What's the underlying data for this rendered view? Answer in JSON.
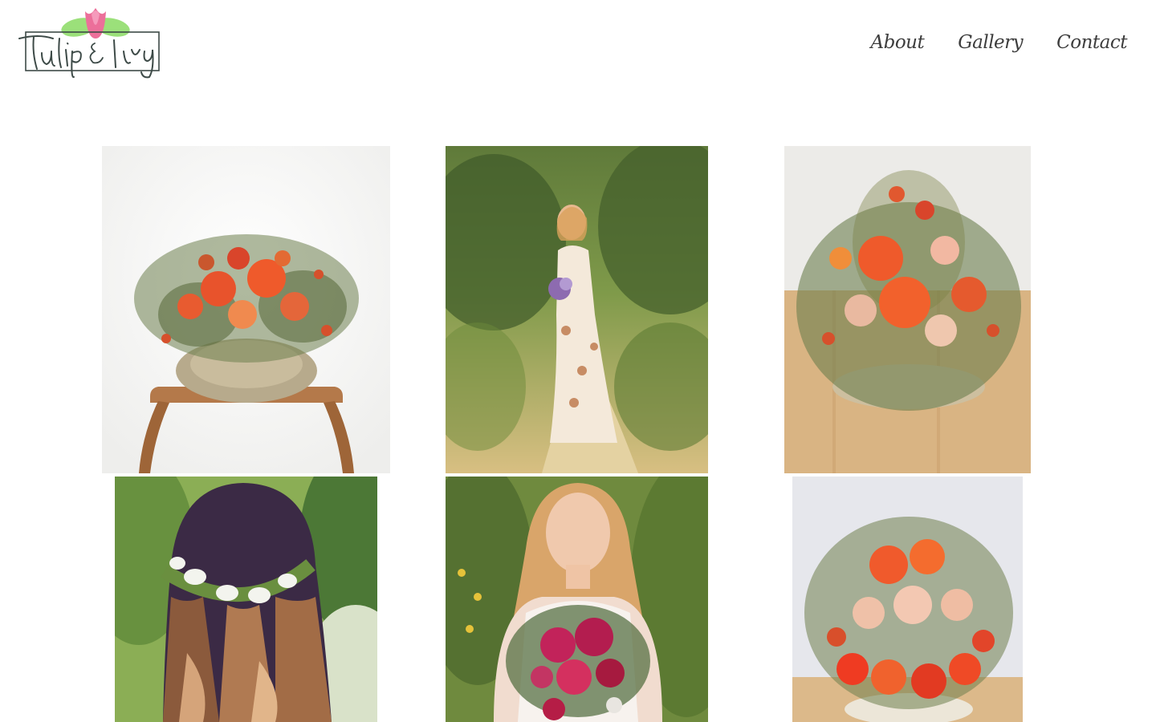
{
  "brand": {
    "logo_text": "Tulip & Ivy",
    "logo_colors": {
      "tulip": "#ec6f9a",
      "leaf": "#9be07a",
      "ink": "#3d4a47"
    }
  },
  "nav": {
    "items": [
      {
        "label": "About"
      },
      {
        "label": "Gallery"
      },
      {
        "label": "Contact"
      }
    ]
  },
  "gallery": {
    "photos": [
      {
        "subject": "orange-rose-pumpkin-centerpiece-on-stool"
      },
      {
        "subject": "bride-in-floral-dress-on-trail"
      },
      {
        "subject": "orange-rose-pumpkin-arrangement-on-wood-table"
      },
      {
        "subject": "white-tulip-flower-crown-back-view"
      },
      {
        "subject": "bride-with-magenta-bouquet"
      },
      {
        "subject": "orange-rose-pumpkin-arrangement-top-view"
      }
    ]
  }
}
